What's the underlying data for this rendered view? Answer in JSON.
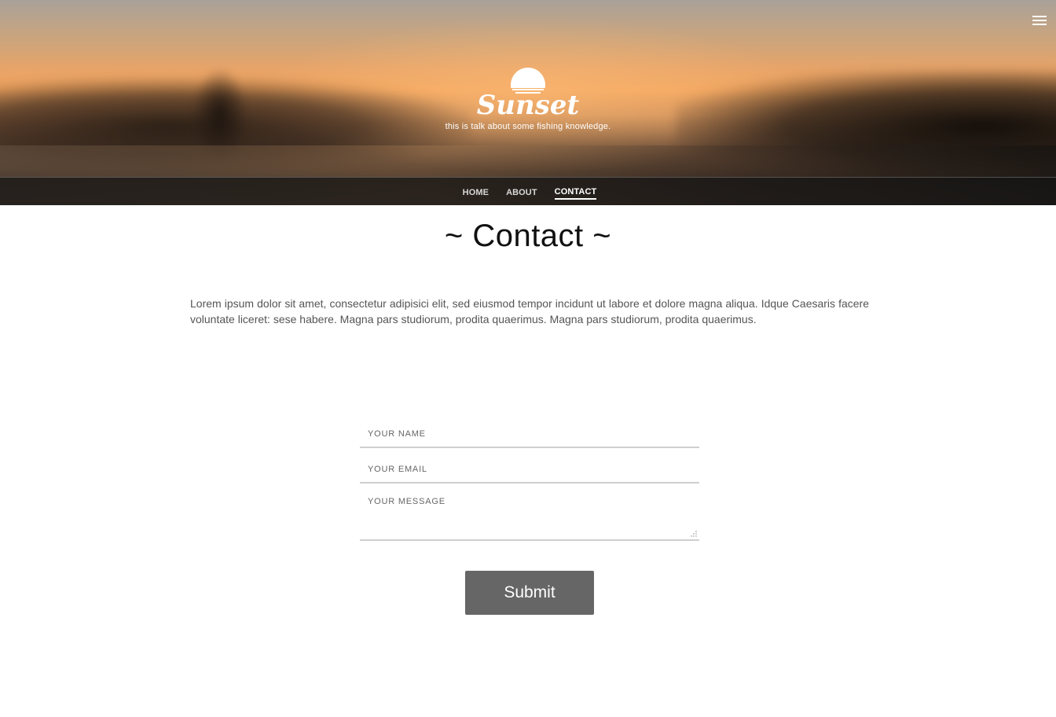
{
  "header": {
    "brand": "Sunset",
    "tagline": "this is talk about some fishing knowledge.",
    "menu_icon": "hamburger-menu-icon"
  },
  "nav": {
    "items": [
      {
        "label": "HOME",
        "active": false
      },
      {
        "label": "ABOUT",
        "active": false
      },
      {
        "label": "CONTACT",
        "active": true
      }
    ]
  },
  "main": {
    "title": "~ Contact ~",
    "intro": "Lorem ipsum dolor sit amet, consectetur adipisici elit, sed eiusmod tempor incidunt ut labore et dolore magna aliqua. Idque Caesaris facere voluntate liceret: sese habere. Magna pars studiorum, prodita quaerimus. Magna pars studiorum, prodita quaerimus."
  },
  "form": {
    "name_placeholder": "YOUR NAME",
    "email_placeholder": "YOUR EMAIL",
    "message_placeholder": "YOUR MESSAGE",
    "name_value": "",
    "email_value": "",
    "message_value": "",
    "submit_label": "Submit"
  },
  "colors": {
    "nav_bar": "#141414",
    "submit_bg": "#666666",
    "field_border": "#cfcfcf",
    "title_text": "#111111"
  }
}
